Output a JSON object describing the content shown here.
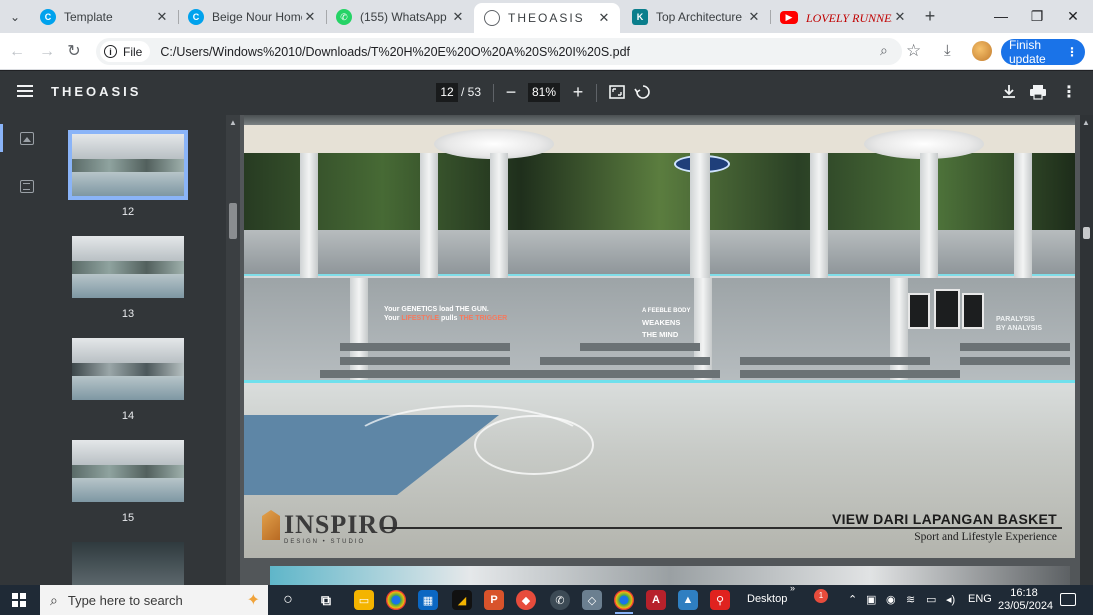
{
  "tabs": [
    {
      "label": "Template",
      "favicon_color": "#00a2ed",
      "favicon_glyph": "C"
    },
    {
      "label": "Beige Nour Home an",
      "favicon_color": "#00a2ed",
      "favicon_glyph": "C"
    },
    {
      "label": "(155) WhatsApp",
      "favicon_color": "#25d366",
      "favicon_glyph": "W"
    },
    {
      "label": "THEOASIS",
      "favicon_color": "#5f6368",
      "favicon_glyph": "globe"
    },
    {
      "label": "Top Architecture Quo",
      "favicon_color": "#0a7e8c",
      "favicon_glyph": "K"
    },
    {
      "label": "LOVELY RUNNER 선",
      "favicon_color": "#ff0000",
      "favicon_glyph": "play"
    }
  ],
  "address": {
    "scheme_chip": "File",
    "url": "C:/Users/Windows%2010/Downloads/T%20H%20E%20O%20A%20S%20I%20S.pdf",
    "finish_update": "Finish update"
  },
  "pdf_toolbar": {
    "doc_title": "THEOASIS",
    "current_page": "12",
    "total_pages": "/ 53",
    "zoom": "81%"
  },
  "thumbnails": [
    {
      "page": "12",
      "selected": true
    },
    {
      "page": "13",
      "selected": false
    },
    {
      "page": "14",
      "selected": false
    },
    {
      "page": "15",
      "selected": false
    }
  ],
  "slide": {
    "wall_text_left_line1": "Your GENETICS load THE GUN.",
    "wall_text_left_line2a": "Your ",
    "wall_text_left_accent1": "LIFESTYLE",
    "wall_text_left_line2b": " pulls ",
    "wall_text_left_accent2": "THE TRIGGER",
    "wall_text_mid": "A FEEBLE BODY",
    "wall_text_mid2": "WEAKENS",
    "wall_text_mid3": "THE MIND",
    "wall_text_right": "PARALYSIS",
    "wall_text_right2": "BY ANALYSIS",
    "logo_name": "INSPIRO",
    "logo_sub": "DESIGN • STUDIO",
    "title": "VIEW DARI LAPANGAN BASKET",
    "subtitle": "Sport and Lifestyle Experience"
  },
  "taskbar": {
    "search_placeholder": "Type here to search",
    "desktop_label": "Desktop",
    "language": "ENG",
    "time": "16:18",
    "date": "23/05/2024"
  }
}
